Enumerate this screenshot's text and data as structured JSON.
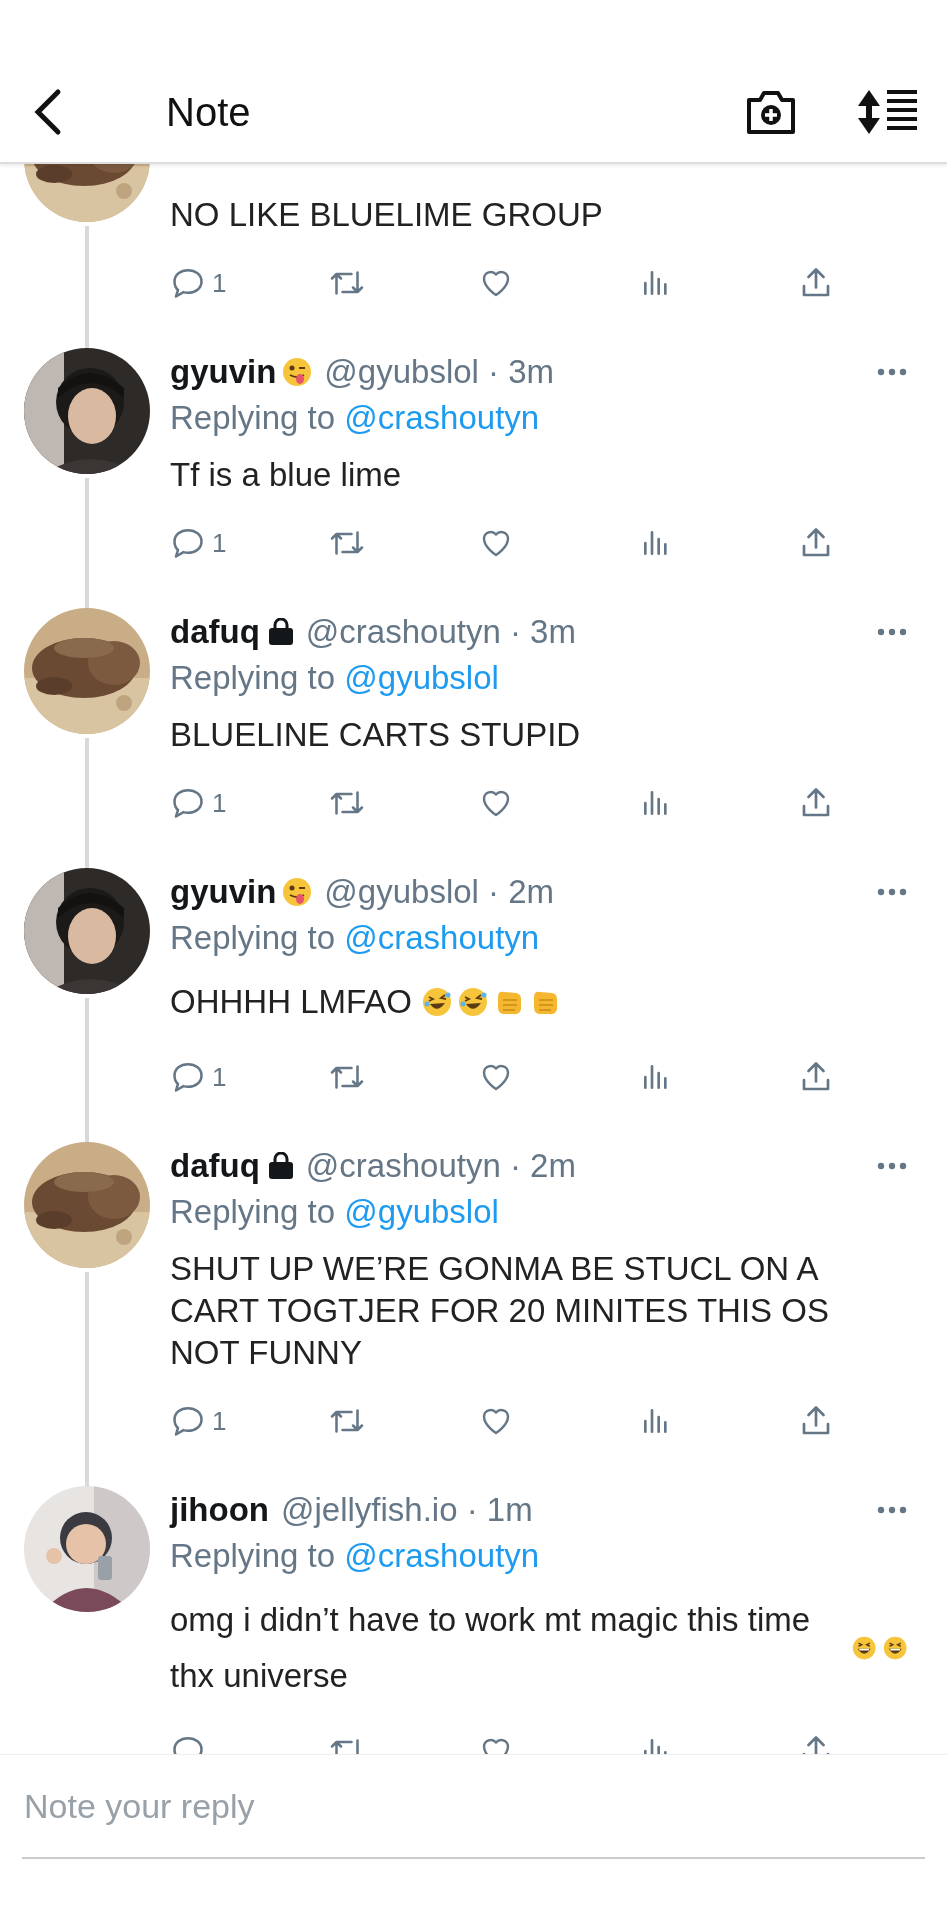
{
  "header": {
    "title": "Note"
  },
  "tweets": [
    {
      "kind": "partial",
      "body": "NO LIKE BLUELIME GROUP",
      "reply_count": "1"
    },
    {
      "kind": "post",
      "name": "gyuvin",
      "name_emoji": {
        "kind": "wink_tongue"
      },
      "meta": "@gyubslol · 3m",
      "replying_label": "Replying to",
      "replying_to": "@crashoutyn",
      "body": "Tf is a blue lime",
      "reply_count": "1"
    },
    {
      "kind": "post",
      "name": "dafuq",
      "locked": true,
      "meta": "@crashoutyn · 3m",
      "replying_label": "Replying to",
      "replying_to": "@gyubslol",
      "body": "BLUELINE CARTS STUPID",
      "reply_count": "1"
    },
    {
      "kind": "post",
      "name": "gyuvin",
      "name_emoji": {
        "kind": "wink_tongue"
      },
      "meta": "@gyubslol · 2m",
      "replying_label": "Replying to",
      "replying_to": "@crashoutyn",
      "body": "OHHHH LMFAO",
      "emojis": [
        {
          "kind": "rofl"
        },
        {
          "kind": "rofl"
        },
        {
          "kind": "point"
        },
        {
          "kind": "point"
        }
      ],
      "reply_count": "1"
    },
    {
      "kind": "post",
      "name": "dafuq",
      "locked": true,
      "meta": "@crashoutyn · 2m",
      "replying_label": "Replying to",
      "replying_to": "@gyubslol",
      "body": "SHUT UP WE’RE GONMA BE STUCL ON A CART TOGTJER FOR 20 MINITES THIS OS NOT FUNNY",
      "reply_count": "1"
    },
    {
      "kind": "post",
      "name": "jihoon",
      "meta": "@jellyfish.io · 1m",
      "replying_label": "Replying to",
      "replying_to": "@crashoutyn",
      "body": "omg i didn’t have to work mt magic this time thx universe",
      "emojis": [
        {
          "kind": "grin"
        },
        {
          "kind": "grin"
        }
      ]
    }
  ],
  "reply_field": {
    "placeholder": "Note your reply"
  }
}
